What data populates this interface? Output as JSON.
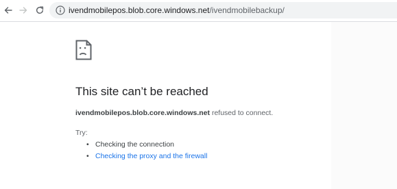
{
  "toolbar": {
    "back_icon": "arrow-left-icon",
    "forward_icon": "arrow-right-icon",
    "reload_icon": "reload-icon",
    "info_icon": "info-icon",
    "url_host": "ivendmobilepos.blob.core.windows.net",
    "url_path": "/ivendmobilebackup/"
  },
  "error": {
    "icon": "sad-page-icon",
    "title": "This site can’t be reached",
    "host": "ivendmobilepos.blob.core.windows.net",
    "message": " refused to connect.",
    "try_label": "Try:",
    "suggestions": [
      {
        "text": "Checking the connection",
        "link": false
      },
      {
        "text": "Checking the proxy and the firewall",
        "link": true
      }
    ]
  },
  "colors": {
    "text_primary": "#202124",
    "text_secondary": "#5f6368",
    "link": "#1a73e8",
    "omnibox_bg": "#f1f3f4"
  }
}
